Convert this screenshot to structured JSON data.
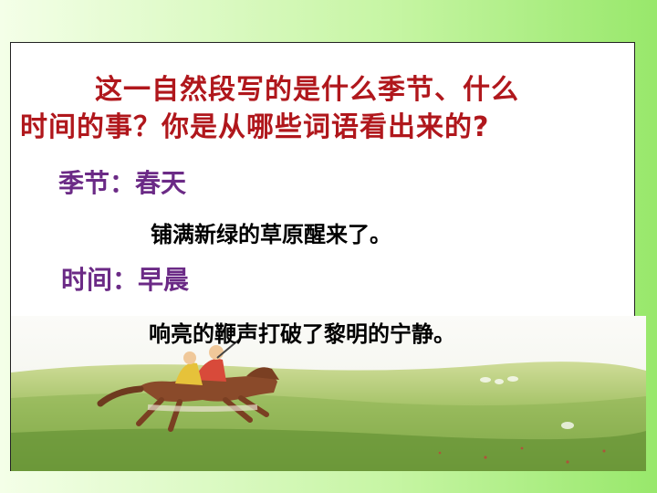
{
  "slide": {
    "question_line1": "这一自然段写的是什么季节、什么",
    "question_line2": "时间的事？你是从哪些词语看出来的?",
    "season_label": "季节：春天",
    "season_phrase": "铺满新绿的草原醒来了。",
    "time_label": "时间：早晨",
    "time_phrase": "响亮的鞭声打破了黎明的宁静。"
  },
  "illustration": {
    "subject": "grassland-horse-riders",
    "colors": {
      "sky": "#f6f7f3",
      "grass_light": "#c9d98a",
      "grass_dark": "#6f9a3a",
      "horse": "#8a4a2a"
    }
  }
}
